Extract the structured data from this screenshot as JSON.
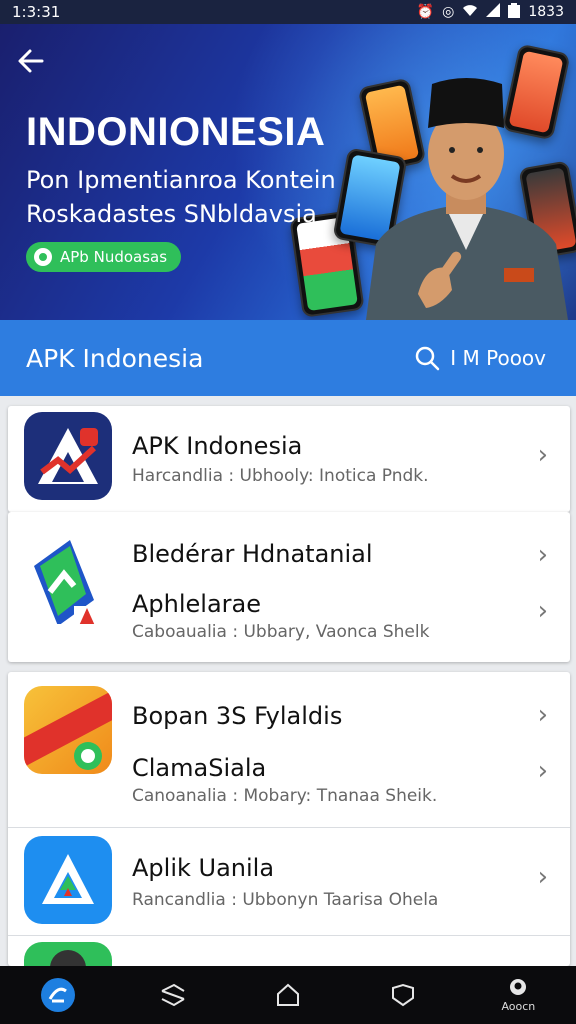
{
  "status_bar": {
    "time": "1:3:31",
    "right_text": "1833"
  },
  "hero": {
    "title": "INDONIONESIA",
    "subtitle_line1": "Pon Ipmentianroa Kontein",
    "subtitle_line2": "Roskadastes SNbldavsia",
    "badge_label": "APb Nudoasas"
  },
  "appbar": {
    "title": "APK Indonesia",
    "search_label": "I M Pooov"
  },
  "cards": [
    {
      "rows": [
        {
          "title": "APK Indonesia",
          "meta": "Harcandlia : Ubhooly: Inotica Pndk."
        }
      ]
    },
    {
      "rows": [
        {
          "title": "Bledérar Hdnatanial",
          "subtitle": "Aphlelarae",
          "meta": "Caboaualia : Ubbary, Vaonca Shelk"
        }
      ]
    },
    {
      "rows": [
        {
          "title": "Bopan 3S Fylaldis",
          "subtitle": "ClamaSiala",
          "meta": "Canoanalia : Mobary: Tnanaa Sheik."
        },
        {
          "title": "Aplik Uanila",
          "meta": "Rancandlia : Ubbonyn Taarisa Ohela"
        }
      ]
    }
  ],
  "navbar": {
    "profile_label": "Aoocn"
  },
  "colors": {
    "appbar": "#2e7de0",
    "badge": "#2fbf5a",
    "hero_dark": "#1a1f6e"
  }
}
